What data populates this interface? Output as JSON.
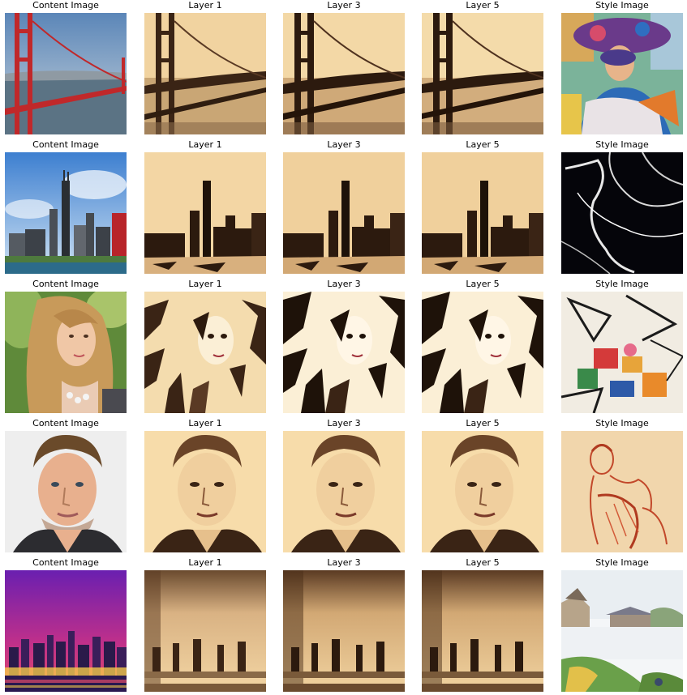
{
  "grid": {
    "rows": [
      {
        "cells": [
          {
            "title": "Content Image",
            "image": "golden-gate-bridge-photo"
          },
          {
            "title": "Layer 1",
            "image": "stylized-bridge-sepia"
          },
          {
            "title": "Layer 3",
            "image": "stylized-bridge-sepia"
          },
          {
            "title": "Layer 5",
            "image": "stylized-bridge-sepia"
          },
          {
            "title": "Style Image",
            "image": "matisse-woman-with-hat-painting"
          }
        ]
      },
      {
        "cells": [
          {
            "title": "Content Image",
            "image": "chicago-skyline-photo"
          },
          {
            "title": "Layer 1",
            "image": "stylized-skyline-sepia"
          },
          {
            "title": "Layer 3",
            "image": "stylized-skyline-sepia"
          },
          {
            "title": "Layer 5",
            "image": "stylized-skyline-sepia"
          },
          {
            "title": "Style Image",
            "image": "black-white-line-abstract"
          }
        ]
      },
      {
        "cells": [
          {
            "title": "Content Image",
            "image": "blonde-woman-portrait-photo"
          },
          {
            "title": "Layer 1",
            "image": "stylized-woman-sepia"
          },
          {
            "title": "Layer 3",
            "image": "stylized-woman-sepia"
          },
          {
            "title": "Layer 5",
            "image": "stylized-woman-sepia"
          },
          {
            "title": "Style Image",
            "image": "de-kooning-abstract-painting"
          }
        ]
      },
      {
        "cells": [
          {
            "title": "Content Image",
            "image": "man-portrait-photo"
          },
          {
            "title": "Layer 1",
            "image": "stylized-man-sepia"
          },
          {
            "title": "Layer 3",
            "image": "stylized-man-sepia"
          },
          {
            "title": "Layer 5",
            "image": "stylized-man-sepia"
          },
          {
            "title": "Style Image",
            "image": "red-chalk-figure-drawing"
          }
        ]
      },
      {
        "cells": [
          {
            "title": "Content Image",
            "image": "night-city-skyline-photo"
          },
          {
            "title": "Layer 1",
            "image": "stylized-night-city-sepia"
          },
          {
            "title": "Layer 3",
            "image": "stylized-night-city-sepia"
          },
          {
            "title": "Layer 5",
            "image": "stylized-night-city-sepia"
          },
          {
            "title": "Style Image",
            "image": "impressionist-river-landscape"
          }
        ]
      }
    ]
  }
}
